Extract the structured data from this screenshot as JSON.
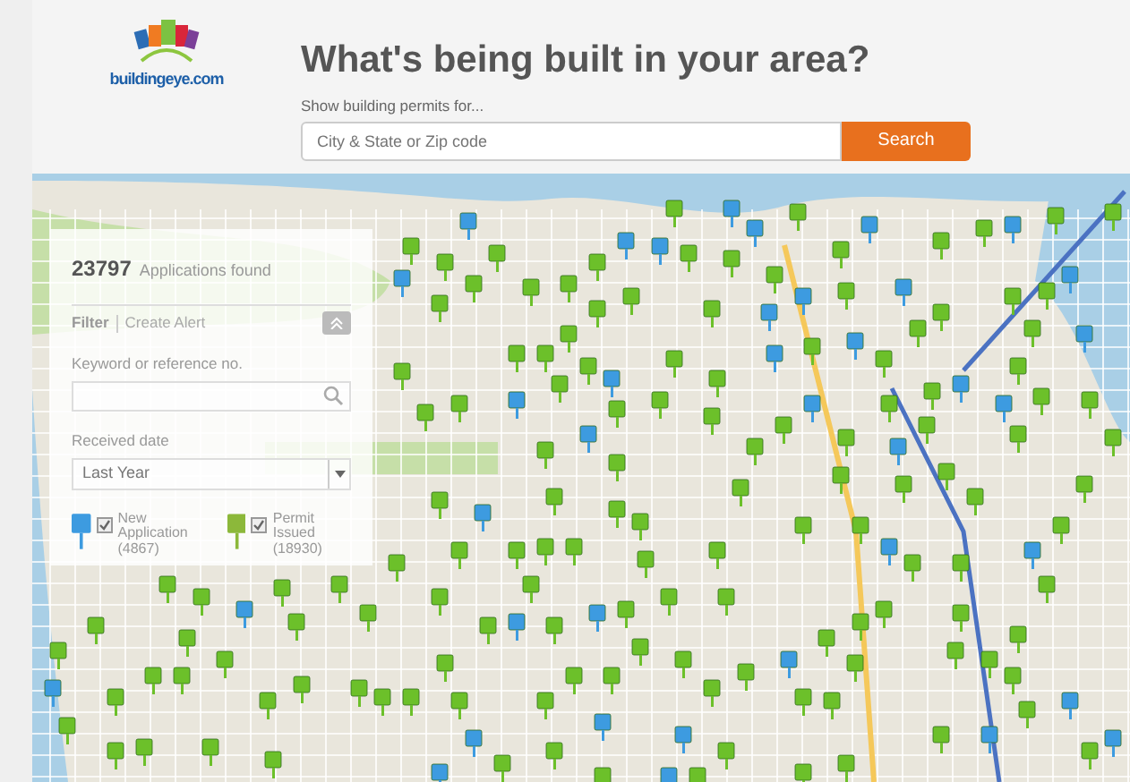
{
  "logo": {
    "text": "buildingeye.com"
  },
  "title": "What's being built in your area?",
  "search": {
    "label": "Show building permits for...",
    "placeholder": "City & State or Zip code",
    "button": "Search"
  },
  "panel": {
    "count": "23797",
    "count_label": "Applications found",
    "tabs": [
      {
        "label": "Filter",
        "selected": true
      },
      {
        "label": "Create Alert",
        "selected": false
      }
    ],
    "keyword_label": "Keyword or reference no.",
    "date": {
      "label": "Received date",
      "value": "Last Year"
    },
    "legend": [
      {
        "label": "New Application",
        "count": "(4867)",
        "checked": true,
        "color": "#3d9be0"
      },
      {
        "label": "Permit Issued",
        "count": "(18930)",
        "checked": true,
        "color": "#8cb83a"
      }
    ]
  }
}
